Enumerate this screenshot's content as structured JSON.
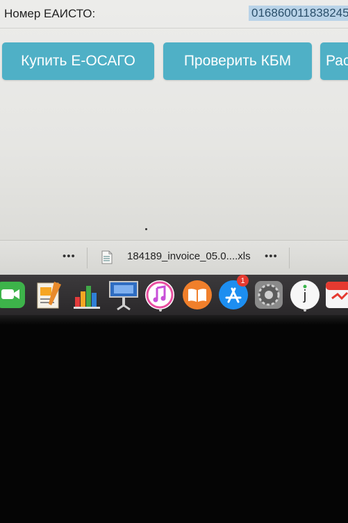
{
  "page": {
    "label": "Номер ЕАИСТО:",
    "value": "016860011838245"
  },
  "buttons": {
    "buy": "Купить Е-ОСАГО",
    "kbm": "Проверить КБМ",
    "calc": "Рас"
  },
  "downloads": {
    "more_left": "•••",
    "file_name": "184189_invoice_05.0....xls",
    "more_right": "•••"
  },
  "dock": {
    "items": [
      "facetime-icon",
      "pages-icon",
      "numbers-icon",
      "keynote-icon",
      "itunes-icon",
      "ibooks-icon",
      "app-store-icon",
      "system-preferences-icon",
      "joxi-icon",
      "pdf-app-icon"
    ],
    "app_store_badge": "1"
  },
  "colors": {
    "button": "#4fb0c6",
    "selection": "#b9d3e8",
    "dock": "#2f2d2f"
  }
}
